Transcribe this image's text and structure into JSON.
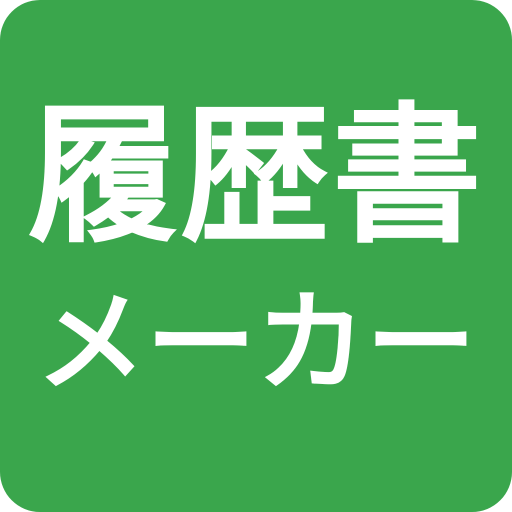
{
  "icon": {
    "line1": "履歴書",
    "line2": "メーカー",
    "background_color": "#3aa64c",
    "text_color": "#ffffff"
  }
}
